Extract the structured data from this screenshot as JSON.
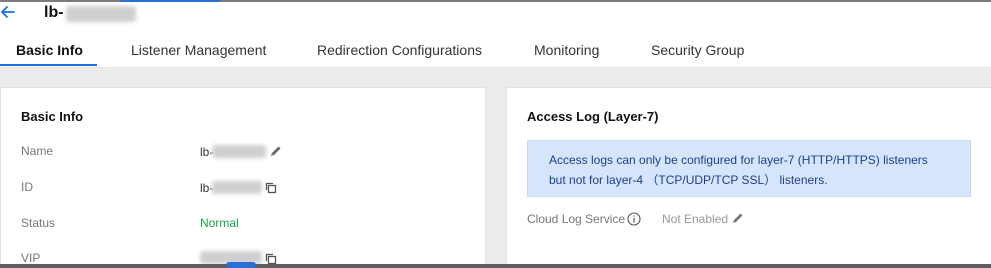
{
  "header": {
    "title_prefix": "lb-"
  },
  "tabs": [
    {
      "label": "Basic Info",
      "active": true
    },
    {
      "label": "Listener Management"
    },
    {
      "label": "Redirection Configurations"
    },
    {
      "label": "Monitoring"
    },
    {
      "label": "Security Group"
    }
  ],
  "basic_info": {
    "title": "Basic Info",
    "rows": {
      "name": {
        "label": "Name",
        "value": "lb-"
      },
      "id": {
        "label": "ID",
        "value": "lb-"
      },
      "status": {
        "label": "Status",
        "value": "Normal"
      },
      "vip": {
        "label": "VIP"
      }
    }
  },
  "access_log": {
    "title": "Access Log (Layer-7)",
    "notice": {
      "line1": "Access logs can only be configured for layer-7 (HTTP/HTTPS) listeners",
      "line2": "but not for layer-4 （TCP/UDP/TCP SSL） listeners."
    },
    "cls": {
      "label": "Cloud Log Service",
      "value": "Not Enabled"
    }
  },
  "icons": {
    "back": "arrow-left-icon",
    "edit": "pencil-icon",
    "copy": "copy-icon",
    "info": "info-circle-icon"
  },
  "colors": {
    "accent": "#1f6fe0",
    "status_ok": "#1aa34a",
    "notice_bg": "#d5e6fc",
    "notice_text": "#1c3f8a"
  }
}
